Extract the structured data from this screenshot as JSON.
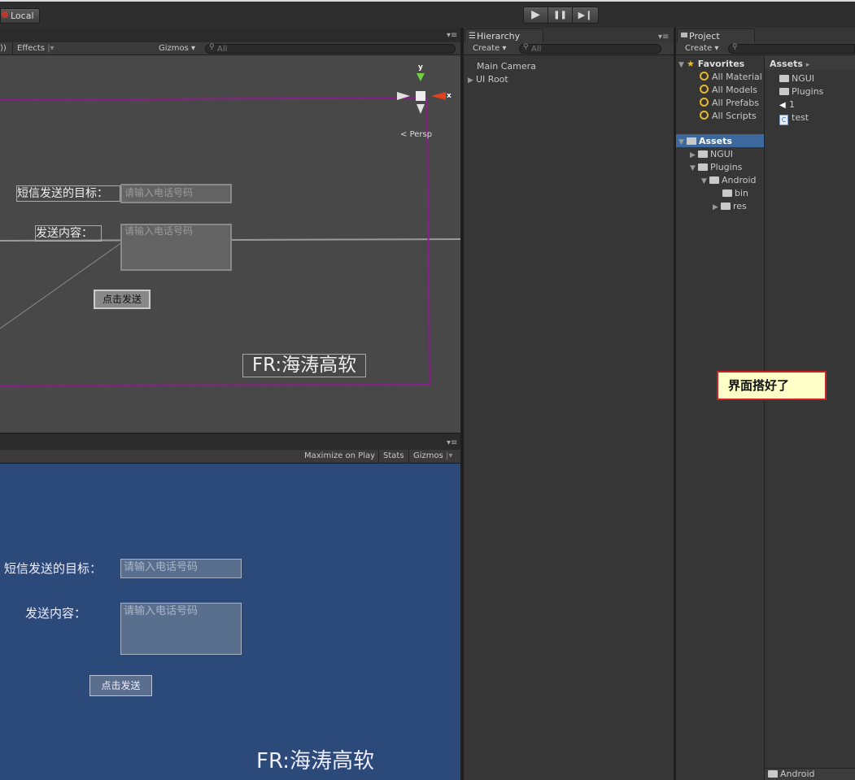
{
  "toolbar": {
    "local_label": "Local",
    "play_icon": "▶",
    "pause_icon": "❚❚",
    "step_icon": "▶❙"
  },
  "scene": {
    "left_icon": "))",
    "effects_label": "Effects",
    "gizmos_label": "Gizmos",
    "search_placeholder": "All",
    "persp_label": "Persp",
    "axis_y": "y",
    "axis_x": "x",
    "ui": {
      "target_label": "短信发送的目标：",
      "target_placeholder": "请输入电话号码",
      "content_label": "发送内容：",
      "content_placeholder": "请输入电话号码",
      "send_button": "点击发送",
      "footer": "FR:海涛高软"
    }
  },
  "game": {
    "maximize_label": "Maximize on Play",
    "stats_label": "Stats",
    "gizmos_label": "Gizmos",
    "ui": {
      "target_label": "短信发送的目标：",
      "target_placeholder": "请输入电话号码",
      "content_label": "发送内容：",
      "content_placeholder": "请输入电话号码",
      "send_button": "点击发送",
      "footer": "FR:海涛高软"
    }
  },
  "hierarchy": {
    "tab_label": "Hierarchy",
    "create_label": "Create",
    "search_placeholder": "All",
    "items": [
      "Main Camera",
      "UI Root"
    ]
  },
  "project": {
    "tab_label": "Project",
    "create_label": "Create",
    "favorites_label": "Favorites",
    "favorites": [
      "All Material",
      "All Models",
      "All Prefabs",
      "All Scripts"
    ],
    "assets_label": "Assets",
    "tree": [
      "NGUI",
      "Plugins",
      "Android",
      "bin",
      "res"
    ],
    "breadcrumb": "Assets",
    "breadcrumb_arrow": "▸",
    "files": [
      "NGUI",
      "Plugins",
      "1",
      "test"
    ],
    "bottom_path": "Android",
    "annotation": "界面搭好了"
  }
}
